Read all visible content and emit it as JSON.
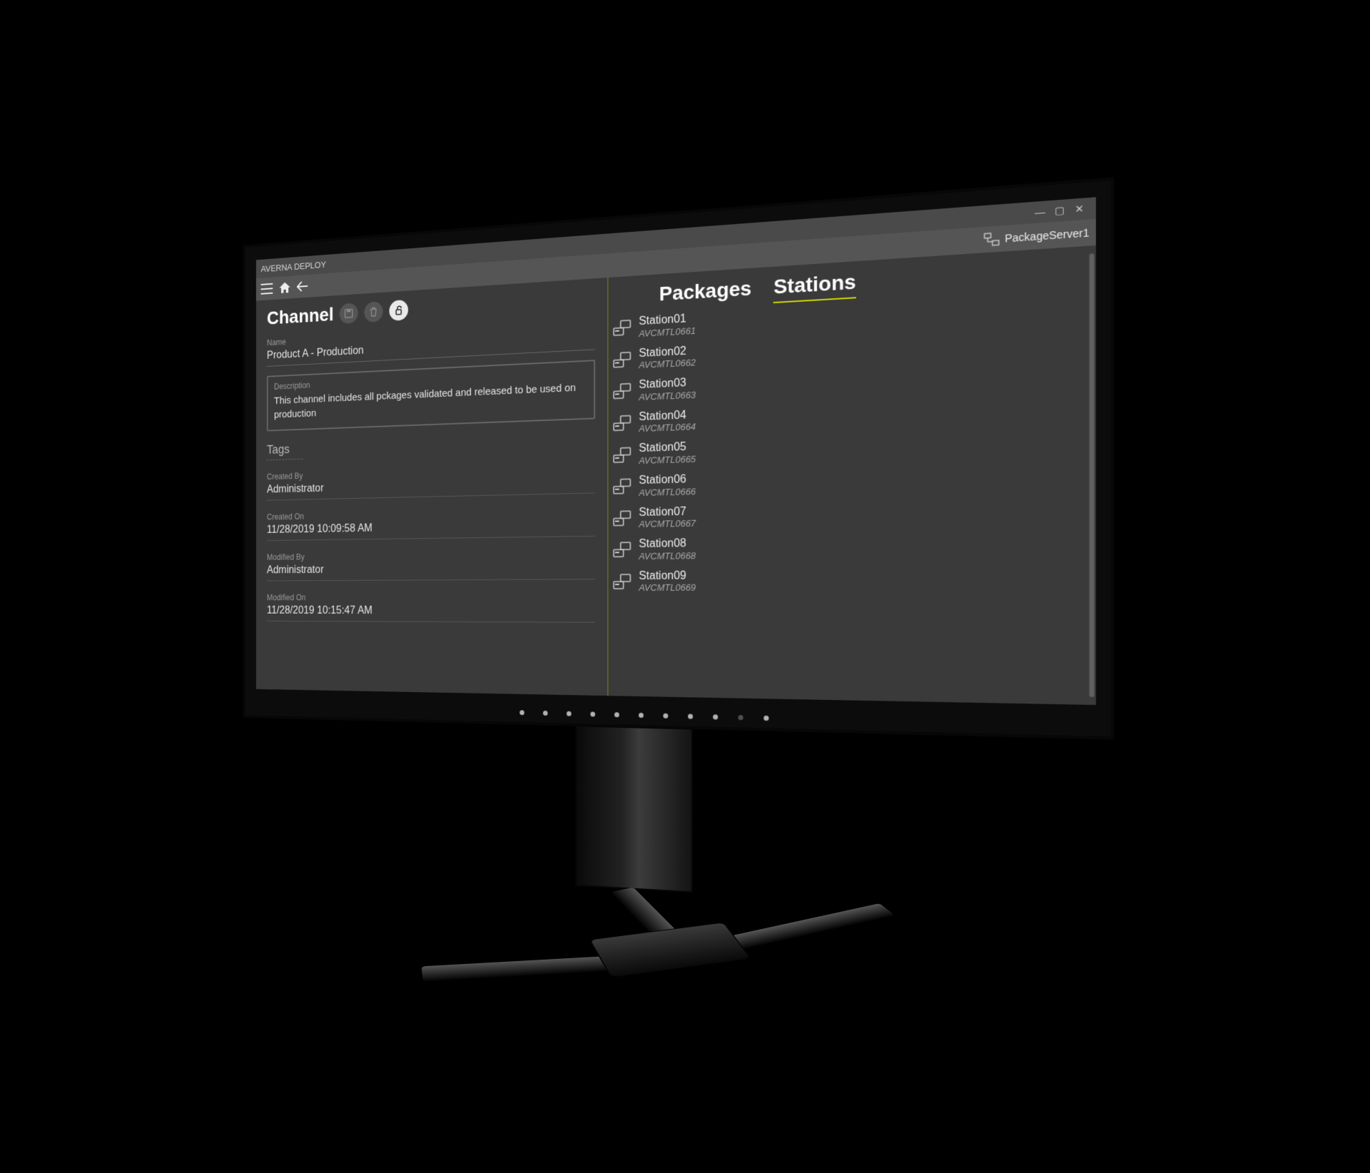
{
  "window": {
    "title": "AVERNA DEPLOY"
  },
  "toolbar": {
    "server_label": "PackageServer1"
  },
  "channel": {
    "heading": "Channel",
    "name_label": "Name",
    "name_value": "Product A - Production",
    "description_label": "Description",
    "description_value": "This channel includes all pckages validated and released to be used on production",
    "tags_heading": "Tags",
    "created_by_label": "Created By",
    "created_by_value": "Administrator",
    "created_on_label": "Created On",
    "created_on_value": "11/28/2019 10:09:58 AM",
    "modified_by_label": "Modified By",
    "modified_by_value": "Administrator",
    "modified_on_label": "Modified On",
    "modified_on_value": "11/28/2019 10:15:47 AM"
  },
  "packages": {
    "heading": "Packages",
    "items": [
      {
        "name": "Station01",
        "host": "AVCMTL0661"
      },
      {
        "name": "Station02",
        "host": "AVCMTL0662"
      },
      {
        "name": "Station03",
        "host": "AVCMTL0663"
      },
      {
        "name": "Station04",
        "host": "AVCMTL0664"
      },
      {
        "name": "Station05",
        "host": "AVCMTL0665"
      },
      {
        "name": "Station06",
        "host": "AVCMTL0666"
      },
      {
        "name": "Station07",
        "host": "AVCMTL0667"
      },
      {
        "name": "Station08",
        "host": "AVCMTL0668"
      },
      {
        "name": "Station09",
        "host": "AVCMTL0669"
      }
    ]
  },
  "stations": {
    "heading": "Stations"
  }
}
